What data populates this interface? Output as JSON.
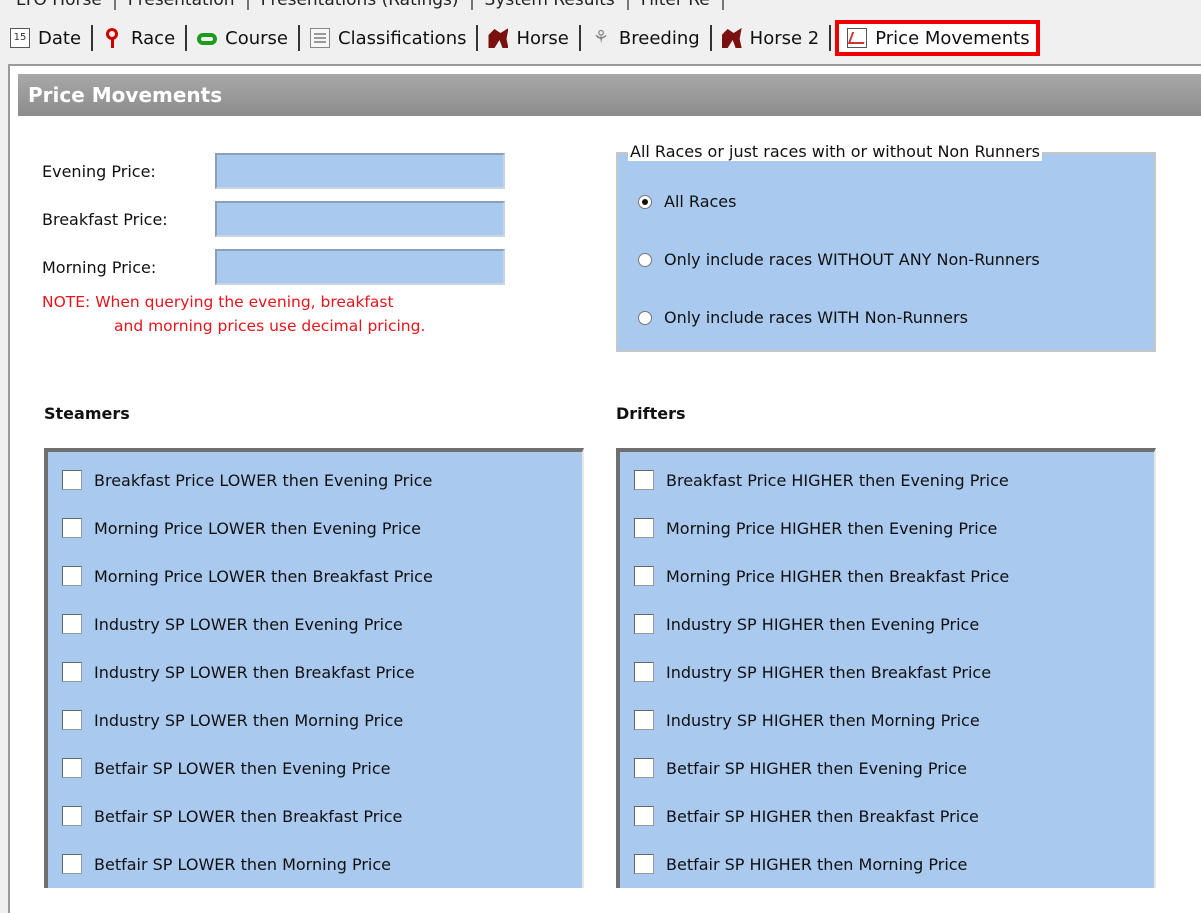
{
  "top_tabs_partial": [
    "LTO Horse",
    "Presentation",
    "Presentations (Ratings)",
    "System Results",
    "Filter Re"
  ],
  "tabs": [
    {
      "label": "Date",
      "icon": "calendar-icon",
      "cal_text": "15"
    },
    {
      "label": "Race",
      "icon": "location-pin-icon"
    },
    {
      "label": "Course",
      "icon": "course-track-icon"
    },
    {
      "label": "Classifications",
      "icon": "document-icon"
    },
    {
      "label": "Horse",
      "icon": "horse-icon"
    },
    {
      "label": "Breeding",
      "icon": "breeding-icon"
    },
    {
      "label": "Horse 2",
      "icon": "horse-icon"
    },
    {
      "label": "Price Movements",
      "icon": "chart-icon",
      "active": true
    }
  ],
  "panel_title": "Price Movements",
  "prices": {
    "evening_label": "Evening Price:",
    "breakfast_label": "Breakfast Price:",
    "morning_label": "Morning Price:",
    "evening_value": "",
    "breakfast_value": "",
    "morning_value": "",
    "note_line1": "NOTE: When querying the evening, breakfast",
    "note_line2": "and morning prices use decimal pricing."
  },
  "non_runners": {
    "title": "All Races or just races with or without Non Runners",
    "options": [
      {
        "label": "All Races",
        "checked": true
      },
      {
        "label": "Only include races WITHOUT ANY Non-Runners",
        "checked": false
      },
      {
        "label": "Only include races WITH Non-Runners",
        "checked": false
      }
    ]
  },
  "steamers": {
    "title": "Steamers",
    "items": [
      "Breakfast Price LOWER then Evening Price",
      "Morning Price LOWER then Evening Price",
      "Morning Price LOWER then Breakfast Price",
      "Industry SP LOWER then Evening Price",
      "Industry SP LOWER then Breakfast Price",
      "Industry SP LOWER then Morning Price",
      "Betfair SP LOWER then Evening Price",
      "Betfair SP LOWER then Breakfast Price",
      "Betfair SP LOWER then Morning Price"
    ]
  },
  "drifters": {
    "title": "Drifters",
    "items": [
      "Breakfast Price HIGHER then Evening Price",
      "Morning Price HIGHER then Evening Price",
      "Morning Price HIGHER then Breakfast Price",
      "Industry SP HIGHER then Evening Price",
      "Industry SP HIGHER then Breakfast Price",
      "Industry SP HIGHER then Morning Price",
      "Betfair SP HIGHER then Evening Price",
      "Betfair SP HIGHER then Breakfast Price",
      "Betfair SP HIGHER then Morning Price"
    ]
  },
  "colors": {
    "highlight": "#e00000",
    "field_bg": "#a9c9ee",
    "note": "#e8141c",
    "header_bg": "#8c8c8c"
  }
}
